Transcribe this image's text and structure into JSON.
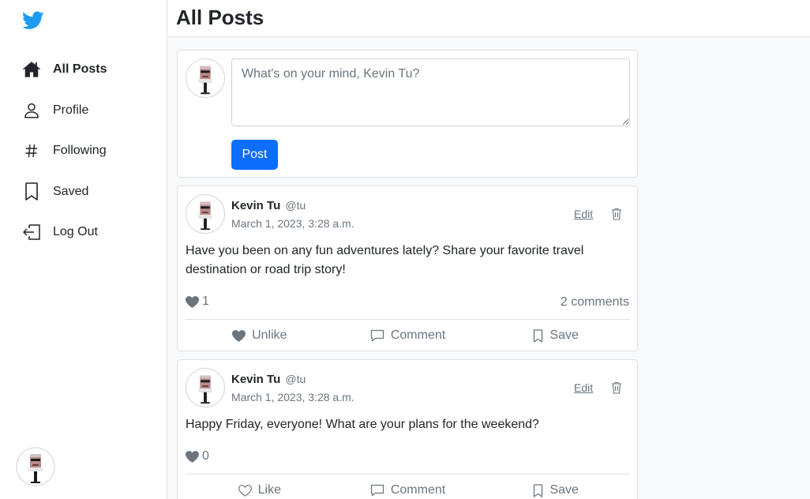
{
  "brand": {
    "logo": "twitter-bird-icon",
    "color": "#1d9bf0"
  },
  "nav": [
    {
      "label": "All Posts",
      "icon": "house-icon",
      "active": true
    },
    {
      "label": "Profile",
      "icon": "person-icon",
      "active": false
    },
    {
      "label": "Following",
      "icon": "hash-icon",
      "active": false
    },
    {
      "label": "Saved",
      "icon": "bookmark-icon",
      "active": false
    },
    {
      "label": "Log Out",
      "icon": "logout-icon",
      "active": false
    }
  ],
  "header": {
    "title": "All Posts"
  },
  "composer": {
    "placeholder": "What's on your mind, Kevin Tu?",
    "value": "",
    "post_label": "Post"
  },
  "posts": [
    {
      "author": "Kevin Tu",
      "handle": "@tu",
      "date": "March 1, 2023, 3:28 a.m.",
      "edit_label": "Edit",
      "content": "Have you been on any fun adventures lately? Share your favorite travel destination or road trip story!",
      "likes": "1",
      "comments": "2 comments",
      "like_label": "Unlike",
      "liked": true,
      "comment_label": "Comment",
      "save_label": "Save"
    },
    {
      "author": "Kevin Tu",
      "handle": "@tu",
      "date": "March 1, 2023, 3:28 a.m.",
      "edit_label": "Edit",
      "content": "Happy Friday, everyone! What are your plans for the weekend?",
      "likes": "0",
      "comments": "",
      "like_label": "Like",
      "liked": false,
      "comment_label": "Comment",
      "save_label": "Save"
    }
  ],
  "colors": {
    "primary": "#0d6efd",
    "muted": "#6c757d",
    "border": "#dee2e6"
  }
}
